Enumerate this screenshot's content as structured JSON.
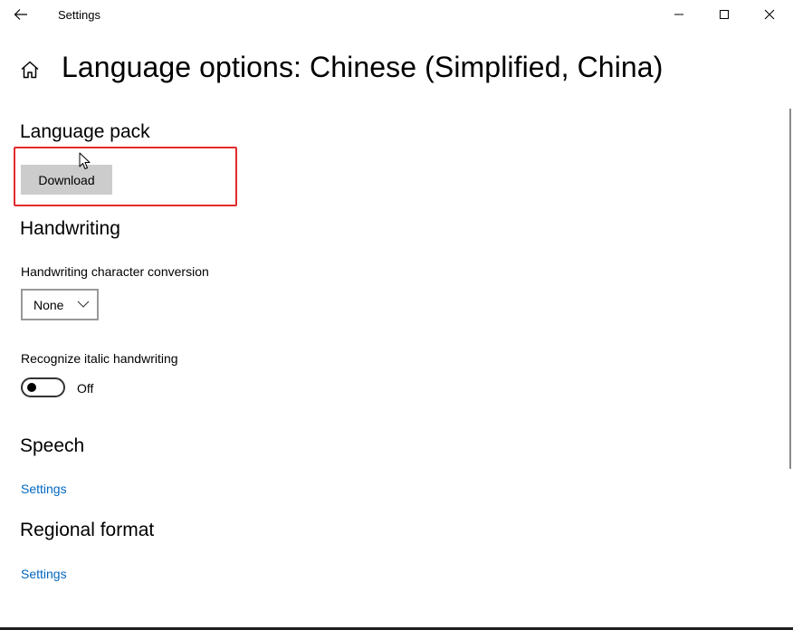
{
  "window": {
    "title": "Settings",
    "back_icon": "arrow-left-icon",
    "minimize_icon": "minimize-icon",
    "maximize_icon": "maximize-icon",
    "close_icon": "close-icon"
  },
  "header": {
    "home_icon": "home-icon",
    "title": "Language options: Chinese (Simplified, China)"
  },
  "language_pack": {
    "heading": "Language pack",
    "download_label": "Download",
    "highlight_color": "#e32b2b"
  },
  "handwriting": {
    "heading": "Handwriting",
    "conversion_label": "Handwriting character conversion",
    "conversion_value": "None",
    "italic_label": "Recognize italic handwriting",
    "italic_state": "Off"
  },
  "speech": {
    "heading": "Speech",
    "link": "Settings"
  },
  "regional_format": {
    "heading": "Regional format",
    "link": "Settings"
  },
  "colors": {
    "link": "#0067c0",
    "button_bg": "#cccccc"
  }
}
